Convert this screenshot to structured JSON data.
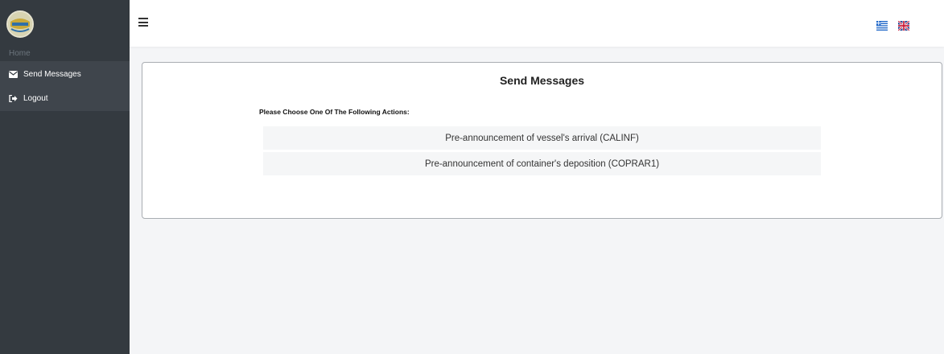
{
  "sidebar": {
    "home_label": "Home",
    "items": [
      {
        "label": "Send Messages",
        "icon": "envelope-icon"
      },
      {
        "label": "Logout",
        "icon": "logout-icon"
      }
    ]
  },
  "header": {
    "menu_icon": "hamburger-icon",
    "languages": [
      "greek-flag-icon",
      "uk-flag-icon"
    ]
  },
  "main": {
    "title": "Send Messages",
    "subtitle": "Please Choose One Of The Following Actions:",
    "actions": [
      {
        "label": "Pre-announcement of vessel's arrival (CALINF)"
      },
      {
        "label": "Pre-announcement of container's deposition (COPRAR1)"
      }
    ]
  },
  "colors": {
    "sidebar_bg": "#343a40",
    "sidebar_active_bg": "#3f454c",
    "page_bg": "#f4f5f7",
    "action_bg": "#f5f6f7"
  }
}
